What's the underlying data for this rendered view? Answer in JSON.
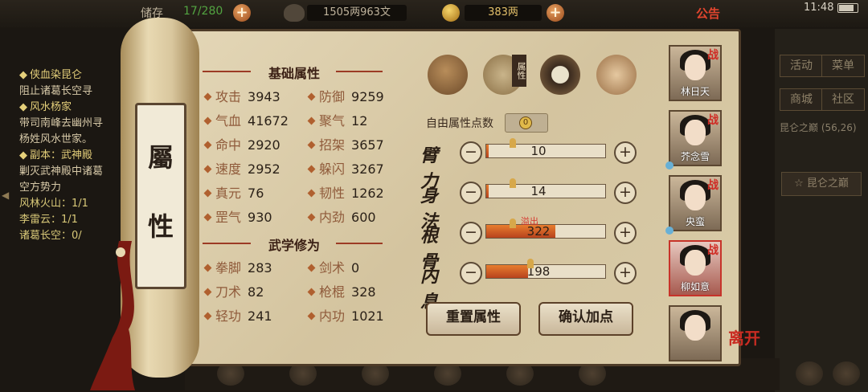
{
  "topbar": {
    "stock_label": "储存",
    "stock_value": "17/280",
    "money_text": "1505两963文",
    "gold_text": "383两",
    "notice_label": "公告",
    "clock": "11:48"
  },
  "quest": {
    "q1_title": "侠血染昆仑",
    "q1_desc": "阻止诸葛长空寻",
    "q2_title": "风水杨家",
    "q2_desc1": "带司南峰去幽州寻",
    "q2_desc2": "杨姓风水世家。",
    "q3_title": "副本：武神殿",
    "q3_desc1": "剿灭武神殿中诸葛",
    "q3_desc2": "空方势力",
    "q3_p1": "风林火山：1/1",
    "q3_p2": "李雷云：1/1",
    "q3_p3": "诸葛长空：0/"
  },
  "scroll_label_top": "屬",
  "scroll_label_bottom": "性",
  "basic": {
    "title": "基础属性",
    "stats": [
      {
        "name": "攻击",
        "value": "3943"
      },
      {
        "name": "防御",
        "value": "9259"
      },
      {
        "name": "气血",
        "value": "41672"
      },
      {
        "name": "聚气",
        "value": "12"
      },
      {
        "name": "命中",
        "value": "2920"
      },
      {
        "name": "招架",
        "value": "3657"
      },
      {
        "name": "速度",
        "value": "2952"
      },
      {
        "name": "躲闪",
        "value": "3267"
      },
      {
        "name": "真元",
        "value": "76"
      },
      {
        "name": "韧性",
        "value": "1262"
      },
      {
        "name": "罡气",
        "value": "930"
      },
      {
        "name": "内劲",
        "value": "600"
      }
    ]
  },
  "martial": {
    "title": "武学修为",
    "stats": [
      {
        "name": "拳脚",
        "value": "283"
      },
      {
        "name": "剑术",
        "value": "0"
      },
      {
        "name": "刀术",
        "value": "82"
      },
      {
        "name": "枪棍",
        "value": "328"
      },
      {
        "name": "轻功",
        "value": "241"
      },
      {
        "name": "内功",
        "value": "1021"
      }
    ]
  },
  "tabs": {
    "attr_tag": "属性"
  },
  "free_points_label": "自由属性点数",
  "free_points_value": "0",
  "attributes": [
    {
      "name": "臂力",
      "value": "10",
      "fill": 0.02
    },
    {
      "name": "身法",
      "value": "14",
      "fill": 0.02
    },
    {
      "name": "根骨",
      "value": "322",
      "fill": 0.58
    },
    {
      "name": "内息",
      "value": "198",
      "fill": 0.35
    }
  ],
  "overflow_label": "溢出",
  "buttons": {
    "reset": "重置属性",
    "confirm": "确认加点"
  },
  "party": [
    {
      "name": "林日天",
      "war": "战"
    },
    {
      "name": "芥念雪",
      "war": "战"
    },
    {
      "name": "央蛮",
      "war": "战"
    },
    {
      "name": "柳如意",
      "war": "战"
    },
    {
      "name": "",
      "war": ""
    }
  ],
  "leave_label": "离开",
  "menu": {
    "activity": "活动",
    "menu": "菜单",
    "shop": "商城",
    "community": "社区"
  },
  "location": {
    "area": "昆仑之巅",
    "coords": "(56,26)",
    "jump": "昆仑之巅"
  },
  "colors": {
    "accent_red": "#c7332a",
    "bar_orange": "#e77d2e",
    "parchment": "#d9cba8"
  }
}
